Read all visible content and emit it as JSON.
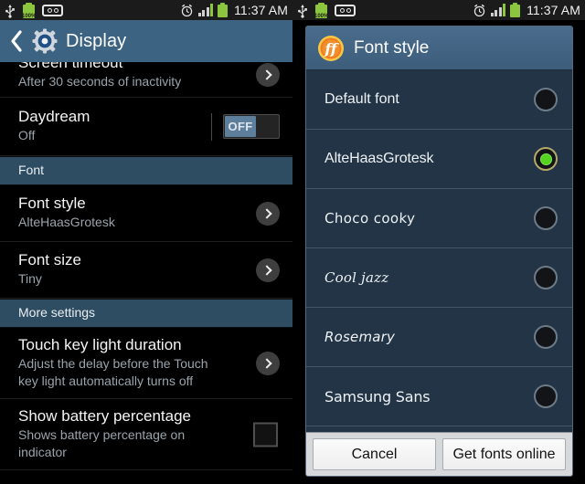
{
  "status_bar": {
    "usb_icon": "usb-icon",
    "battery_percent_label": "100%",
    "voicemail_icon": "voicemail-icon",
    "alarm_icon": "alarm-clock-icon",
    "signal_icon": "signal-bars-icon",
    "battery_icon": "battery-icon",
    "time": "11:37 AM"
  },
  "left_screen": {
    "action_bar": {
      "back_icon": "back-chevron-icon",
      "app_icon": "settings-gear-icon",
      "title": "Display"
    },
    "rows": [
      {
        "id": "screen-timeout",
        "type": "nav",
        "title": "Screen timeout",
        "subtitle": "After 30 seconds of inactivity",
        "clipped": true
      },
      {
        "id": "daydream",
        "type": "toggle",
        "title": "Daydream",
        "subtitle": "Off",
        "toggle_state": "OFF"
      },
      {
        "id": "font-section",
        "type": "section",
        "title": "Font"
      },
      {
        "id": "font-style",
        "type": "nav",
        "title": "Font style",
        "subtitle": "AlteHaasGrotesk"
      },
      {
        "id": "font-size",
        "type": "nav",
        "title": "Font size",
        "subtitle": "Tiny"
      },
      {
        "id": "more-settings-section",
        "type": "section",
        "title": "More settings"
      },
      {
        "id": "touch-key-light-duration",
        "type": "nav",
        "title": "Touch key light duration",
        "subtitle": "Adjust the delay before the Touch key light automatically turns off"
      },
      {
        "id": "show-battery-percentage",
        "type": "checkbox",
        "title": "Show battery percentage",
        "subtitle": "Shows battery percentage on indicator",
        "checked": false
      }
    ]
  },
  "right_screen": {
    "dialog": {
      "icon": "font-ff-icon",
      "title": "Font style",
      "options": [
        {
          "label": "Default font",
          "selected": false,
          "style": "f-default"
        },
        {
          "label": "AlteHaasGrotesk",
          "selected": true,
          "style": "f-alte"
        },
        {
          "label": "Choco cooky",
          "selected": false,
          "style": "f-choco"
        },
        {
          "label": "Cool jazz",
          "selected": false,
          "style": "f-cool"
        },
        {
          "label": "Rosemary",
          "selected": false,
          "style": "f-rose"
        },
        {
          "label": "Samsung Sans",
          "selected": false,
          "style": "f-samsung"
        }
      ],
      "buttons": {
        "cancel": "Cancel",
        "get_fonts": "Get fonts online"
      }
    }
  },
  "colors": {
    "action_bar": "#3c6382",
    "section_header": "#2e4d63",
    "dialog_body": "#223445",
    "selected_green": "#55d41f",
    "battery_green": "#8cc63e"
  }
}
